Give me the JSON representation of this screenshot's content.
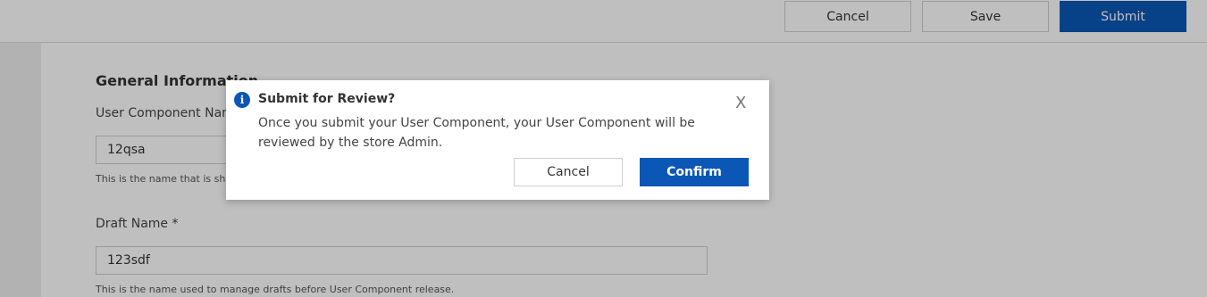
{
  "toolbar": {
    "cancel_label": "Cancel",
    "save_label": "Save",
    "submit_label": "Submit"
  },
  "form": {
    "section_title": "General Information",
    "component_name_label": "User Component Name",
    "component_name_value": "12qsa",
    "component_name_helper": "This is the name that is shown",
    "draft_name_label": "Draft Name *",
    "draft_name_value": "123sdf",
    "draft_name_helper": "This is the name used to manage drafts before User Component release."
  },
  "dialog": {
    "title": "Submit for Review?",
    "body": "Once you submit your User Component, your User Component will be reviewed by the store Admin.",
    "close_glyph": "X",
    "cancel_label": "Cancel",
    "confirm_label": "Confirm",
    "info_glyph": "i"
  },
  "colors": {
    "primary": "#0a57b5",
    "overlay": "rgba(0,0,0,0.25)"
  }
}
